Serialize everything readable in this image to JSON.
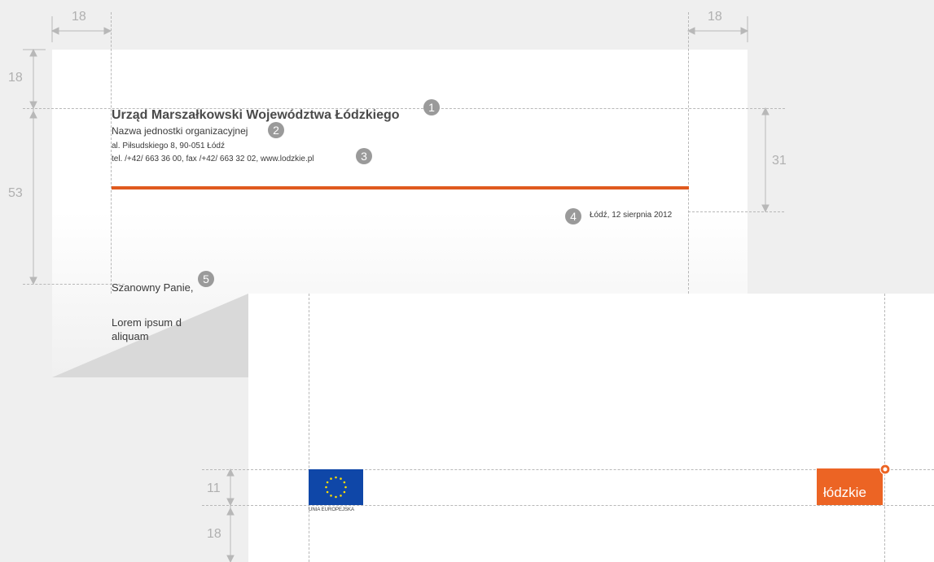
{
  "letterhead": {
    "institution": "Urząd Marszałkowski Województwa Łódzkiego",
    "unit": "Nazwa jednostki organizacyjnej",
    "address": "al. Piłsudskiego 8, 90-051 Łódź",
    "contact": "tel. /+42/ 663 36 00, fax /+42/ 663 32 02, www.lodzkie.pl",
    "rule_color": "#e05a1e"
  },
  "letter": {
    "date": "Łódź, 12 sierpnia 2012",
    "salutation": "Szanowny Panie,",
    "body_line1": "Lorem ipsum d",
    "body_line2": "aliquam"
  },
  "callouts": [
    "1",
    "2",
    "3",
    "4",
    "5"
  ],
  "dimensions": {
    "margin_left": "18",
    "margin_right": "18",
    "top_margin": "18",
    "header_height": "53",
    "date_offset": "31",
    "footer_logo_height": "11",
    "footer_margin": "18"
  },
  "footer": {
    "eu_label": "UNIA EUROPEJSKA",
    "logo_text": "łódzkie",
    "eu_color": "#0f47a8",
    "logo_color": "#ec6424"
  }
}
